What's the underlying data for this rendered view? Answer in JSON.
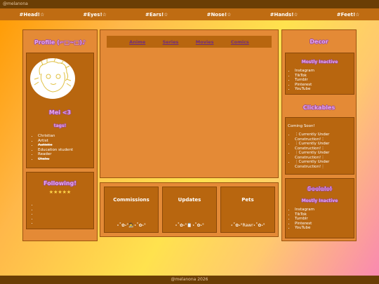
{
  "topbar": {
    "user": "@melanona"
  },
  "nav": [
    "#Head!☆",
    "#Eyes!☆",
    "#Ears!☆",
    "#Nose!☆",
    "#Hands!☆",
    "#Feet!☆"
  ],
  "profile": {
    "title": "Profile (⌐□~□)♪",
    "name": "Mei <3",
    "tags_title": "tags!",
    "tags": [
      {
        "text": "Christian",
        "strike": false
      },
      {
        "text": "Artist",
        "strike": false
      },
      {
        "text": "Autistic",
        "strike": true
      },
      {
        "text": "Education student",
        "strike": false
      },
      {
        "text": "Reader",
        "strike": false
      },
      {
        "text": "Otaku",
        "strike": true
      }
    ]
  },
  "following": {
    "title": "Following!",
    "stars": "★★★★★",
    "items": [
      "",
      "",
      "",
      "",
      ""
    ]
  },
  "tabs": [
    "Anime",
    "Series",
    "Movies",
    "Comics"
  ],
  "boxes": [
    {
      "title": "Commissions",
      "deco": "⋆˚✿˖°🧑‍🎨⋆˚✿˖°"
    },
    {
      "title": "Updates",
      "deco": "⋆˚✿˖°📋⋆˚✿˖°"
    },
    {
      "title": "Pets",
      "deco": "⋆˚✿˖°Rawr⋆˚✿˖°"
    }
  ],
  "decor": {
    "title": "Decor",
    "subtitle": "Mostly Inactive",
    "links": [
      "Instagram",
      "TikTok",
      "Tumblr",
      "Pinterest",
      "YouTube"
    ]
  },
  "clickables": {
    "title": "Clickables",
    "note": "Coming Soon!",
    "items": [
      "⋮Currently Under Construction!⋮",
      "⋮Currently Under Construction!⋮",
      "⋮Currently Under Construction!⋮",
      "⋮Currently Under Construction!⋮"
    ]
  },
  "socials": {
    "title": "Socials!",
    "subtitle": "Mostly Inactive",
    "links": [
      "Instagram",
      "TikTok",
      "Tumblr",
      "Pinterest",
      "YouTube"
    ]
  },
  "footer": {
    "text": "@melanona 2026"
  }
}
